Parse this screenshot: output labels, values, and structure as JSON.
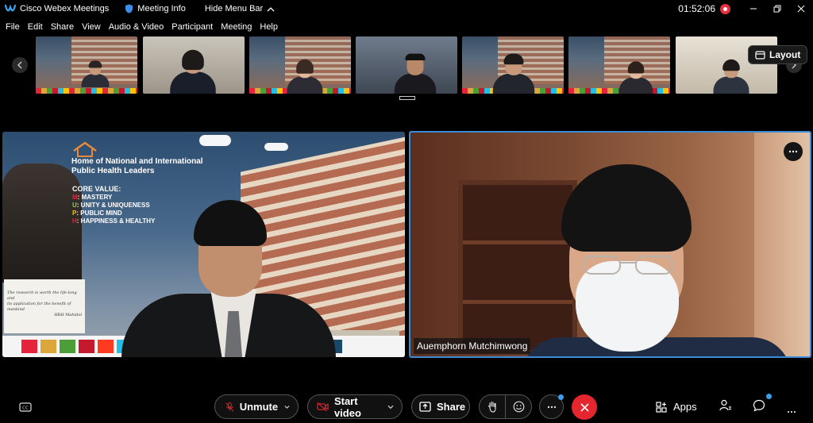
{
  "titlebar": {
    "app_title": "Cisco Webex Meetings",
    "meeting_info": "Meeting Info",
    "hide_menu": "Hide Menu Bar",
    "timer": "01:52:06"
  },
  "menu": [
    "File",
    "Edit",
    "Share",
    "View",
    "Audio & Video",
    "Participant",
    "Meeting",
    "Help"
  ],
  "filmstrip": {
    "layout_label": "Layout",
    "thumbnails": 7
  },
  "stage": {
    "slide": {
      "title_line1": "Home of National and International",
      "title_line2": "Public Health Leaders",
      "core_title": "CORE VALUE:",
      "core_items": [
        {
          "key": "M",
          "text": "MASTERY"
        },
        {
          "key": "U",
          "text": "UNITY & UNIQUENESS"
        },
        {
          "key": "P",
          "text": "PUBLIC MIND"
        },
        {
          "key": "H",
          "text": "HAPPINESS & HEALTHY"
        }
      ],
      "note_line1": "The research is worth the life-long and",
      "note_line2": "its application for the benefit of mankind",
      "note_line3": "HRH Mahidol"
    },
    "speaker_name": "Auemphorn Mutchimwong"
  },
  "controls": {
    "unmute": "Unmute",
    "start_video": "Start video",
    "share": "Share",
    "apps": "Apps"
  },
  "colors": {
    "accent_blue": "#3d8bd4",
    "end_red": "#e5262e",
    "rec_red": "#e8303f",
    "notify_dot": "#3d9ef0"
  }
}
